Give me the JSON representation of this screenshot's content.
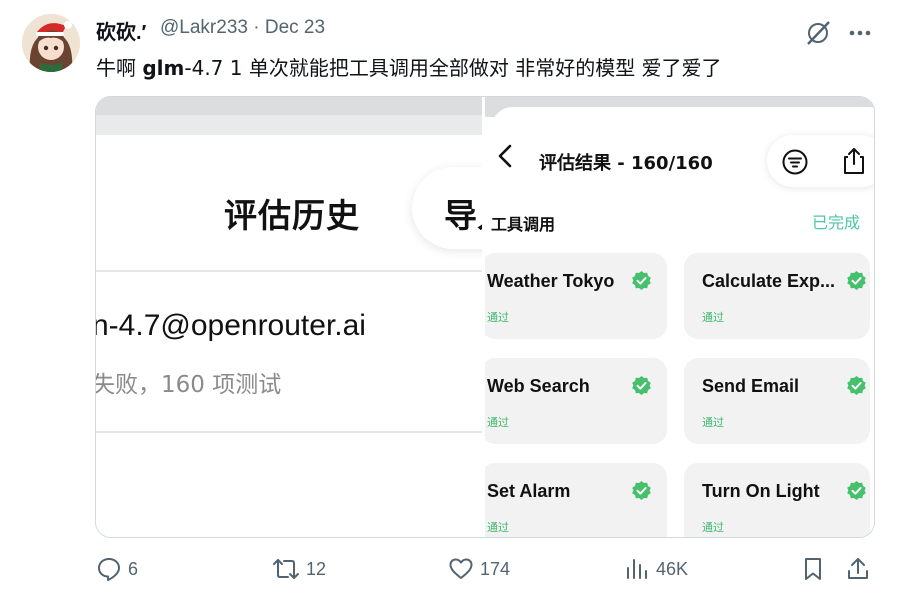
{
  "tweet": {
    "author_name": "砍砍.′",
    "author_handle": "@Lakr233",
    "separator": "·",
    "date": "Dec 23",
    "text_prefix": "牛啊 ",
    "text_bold": "glm",
    "text_suffix": "-4.7 1 单次就能把工具调用全部做对 非常好的模型 爱了爱了"
  },
  "left_image": {
    "title": "评估历史",
    "nav_partial": "导入",
    "model_email": "n-4.7@openrouter.ai",
    "summary": "失败，160 项测试"
  },
  "right_image": {
    "title": "评估结果 - 160/160",
    "section_label": "工具调用",
    "section_status": "已完成",
    "cards": [
      {
        "name": "Weather Tokyo",
        "status": "通过"
      },
      {
        "name": "Calculate Exp...",
        "status": "通过"
      },
      {
        "name": "Web Search",
        "status": "通过"
      },
      {
        "name": "Send Email",
        "status": "通过"
      },
      {
        "name": "Set Alarm",
        "status": "通过"
      },
      {
        "name": "Turn On Light",
        "status": "通过"
      }
    ]
  },
  "actions": {
    "replies": "6",
    "reposts": "12",
    "likes": "174",
    "views": "46K"
  },
  "colors": {
    "accent_green": "#4fc6a3",
    "check_green": "#3fb96b",
    "muted": "#536471"
  },
  "icons": [
    "grok-icon",
    "more-icon",
    "chevron-left-icon",
    "filter-icon",
    "share-icon",
    "check-badge-icon",
    "reply-icon",
    "repost-icon",
    "like-icon",
    "views-icon",
    "bookmark-icon"
  ]
}
